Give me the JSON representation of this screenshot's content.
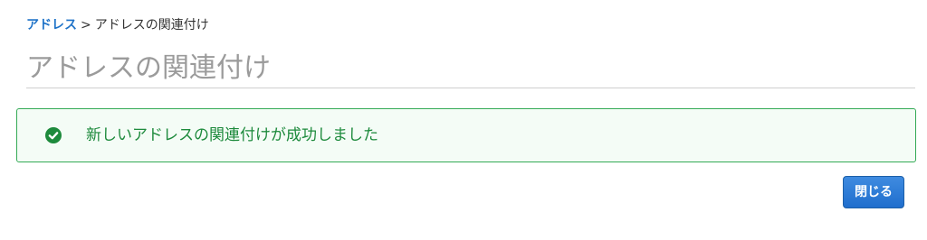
{
  "breadcrumb": {
    "parent_label": "アドレス",
    "separator": ">",
    "current_label": "アドレスの関連付け"
  },
  "page": {
    "title": "アドレスの関連付け"
  },
  "alert": {
    "status": "success",
    "icon": "check-circle-icon",
    "message": "新しいアドレスの関連付けが成功しました",
    "color": "#1d8a3c"
  },
  "actions": {
    "close_label": "閉じる"
  },
  "colors": {
    "link": "#1f73c8",
    "success": "#33aa55",
    "primary_button": "#1f6ecd"
  }
}
